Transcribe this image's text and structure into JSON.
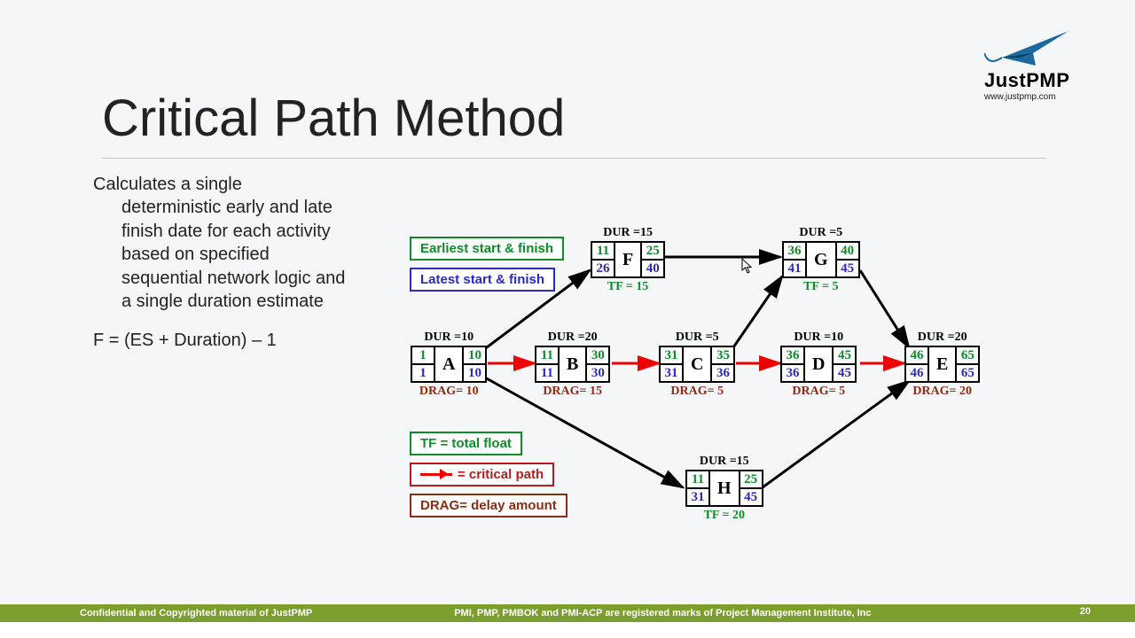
{
  "header": {
    "title": "Critical Path Method",
    "logo_text": "JustPMP",
    "logo_sub": "www.justpmp.com"
  },
  "content": {
    "para_first": "Calculates a single",
    "para_rest": "deterministic early and late finish date for each activity based on specified sequential network logic and a single duration estimate",
    "formula": "F = (ES + Duration) – 1"
  },
  "legend": {
    "earliest": "Earliest start & finish",
    "latest": "Latest start & finish",
    "tf": "TF = total float",
    "cp": "= critical path",
    "drag": "DRAG= delay amount"
  },
  "nodes": {
    "A": {
      "label": "A",
      "dur": "DUR =10",
      "es": "1",
      "ef": "10",
      "ls": "1",
      "lf": "10",
      "bottom": "DRAG= 10",
      "bottom_class": "drag-txt"
    },
    "B": {
      "label": "B",
      "dur": "DUR =20",
      "es": "11",
      "ef": "30",
      "ls": "11",
      "lf": "30",
      "bottom": "DRAG= 15",
      "bottom_class": "drag-txt"
    },
    "C": {
      "label": "C",
      "dur": "DUR =5",
      "es": "31",
      "ef": "35",
      "ls": "31",
      "lf": "36",
      "bottom": "DRAG= 5",
      "bottom_class": "drag-txt"
    },
    "D": {
      "label": "D",
      "dur": "DUR =10",
      "es": "36",
      "ef": "45",
      "ls": "36",
      "lf": "45",
      "bottom": "DRAG= 5",
      "bottom_class": "drag-txt"
    },
    "E": {
      "label": "E",
      "dur": "DUR =20",
      "es": "46",
      "ef": "65",
      "ls": "46",
      "lf": "65",
      "bottom": "DRAG= 20",
      "bottom_class": "drag-txt"
    },
    "F": {
      "label": "F",
      "dur": "DUR =15",
      "es": "11",
      "ef": "25",
      "ls": "26",
      "lf": "40",
      "bottom": "TF = 15",
      "bottom_class": "tf-txt"
    },
    "G": {
      "label": "G",
      "dur": "DUR =5",
      "es": "36",
      "ef": "40",
      "ls": "41",
      "lf": "45",
      "bottom": "TF = 5",
      "bottom_class": "tf-txt"
    },
    "H": {
      "label": "H",
      "dur": "DUR =15",
      "es": "11",
      "ef": "25",
      "ls": "31",
      "lf": "45",
      "bottom": "TF = 20",
      "bottom_class": "tf-txt"
    }
  },
  "footer": {
    "left": "Confidential and Copyrighted material of JustPMP",
    "mid": "PMI, PMP, PMBOK and PMI-ACP are registered marks of Project Management Institute, Inc",
    "page": "20"
  }
}
